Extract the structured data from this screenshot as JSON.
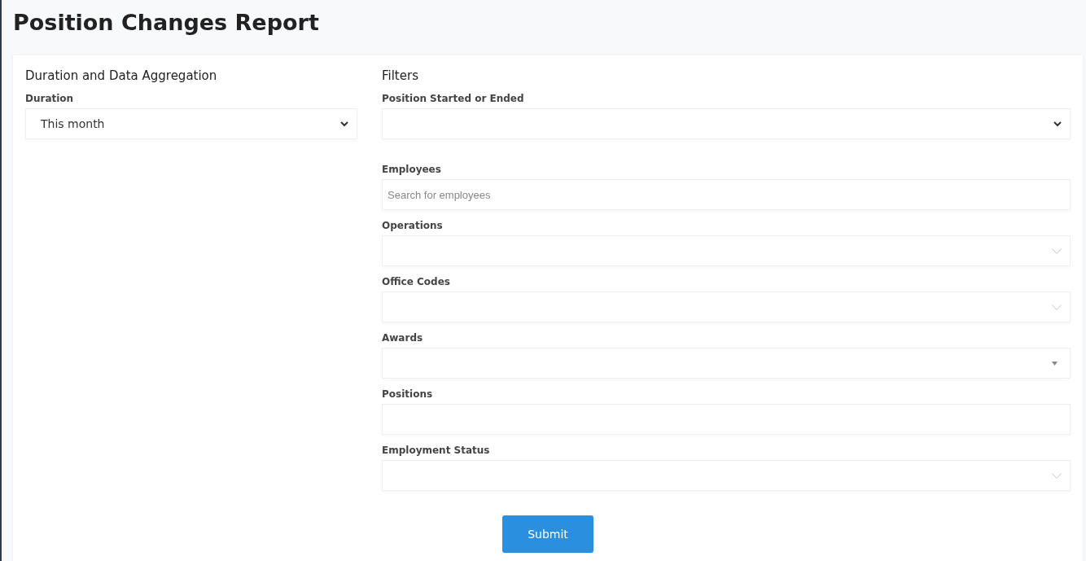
{
  "page": {
    "title": "Position Changes Report"
  },
  "duration_section": {
    "heading": "Duration and Data Aggregation",
    "fields": [
      {
        "label": "Duration",
        "kind": "select",
        "value": "This month"
      }
    ]
  },
  "filters_section": {
    "heading": "Filters",
    "fields": [
      {
        "label": "Position Started or Ended",
        "kind": "select"
      },
      {
        "label": "Employees",
        "kind": "search",
        "placeholder": "Search for employees"
      },
      {
        "label": "Operations",
        "kind": "multiselect"
      },
      {
        "label": "Office Codes",
        "kind": "multiselect"
      },
      {
        "label": "Awards",
        "kind": "dropdown"
      },
      {
        "label": "Positions",
        "kind": "text"
      },
      {
        "label": "Employment Status",
        "kind": "multiselect"
      }
    ]
  },
  "submit_button": {
    "label": "Submit"
  }
}
